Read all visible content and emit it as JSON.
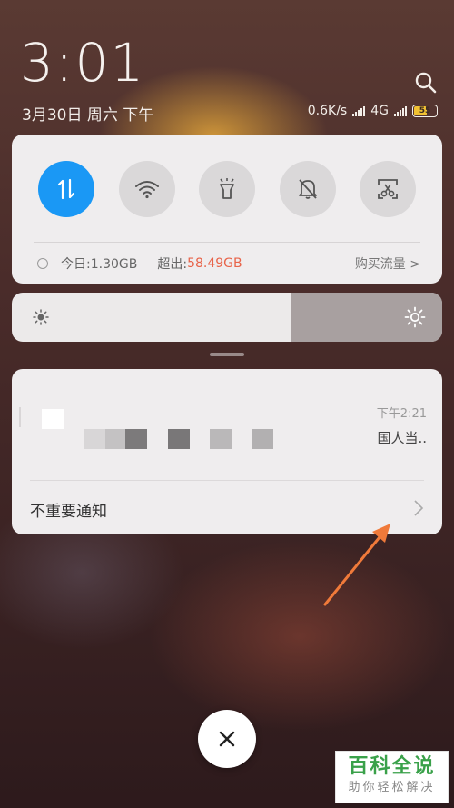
{
  "status": {
    "time": "3:01",
    "date": "3月30日 周六 下午",
    "net_speed": "0.6K/s",
    "network": "4G",
    "battery": "55"
  },
  "toggles": [
    {
      "name": "data",
      "icon": "mobile-data-icon",
      "active": true
    },
    {
      "name": "wifi",
      "icon": "wifi-icon",
      "active": false
    },
    {
      "name": "flashlight",
      "icon": "flashlight-icon",
      "active": false
    },
    {
      "name": "mute",
      "icon": "bell-off-icon",
      "active": false
    },
    {
      "name": "screenshot",
      "icon": "scissors-screenshot-icon",
      "active": false
    }
  ],
  "data_usage": {
    "today": "今日:1.30GB",
    "over_label": "超出:",
    "over_value": "58.49GB",
    "buy": "购买流量 >"
  },
  "brightness": {
    "level": 0.65
  },
  "notification": {
    "time": "下午2:21",
    "text": "国人当..",
    "group_label": "不重要通知"
  },
  "watermark": {
    "title": "百科全说",
    "subtitle": "助你轻松解决"
  },
  "colors": {
    "accent": "#1a98f5",
    "over": "#e8644a",
    "arrow": "#f07a3a"
  }
}
